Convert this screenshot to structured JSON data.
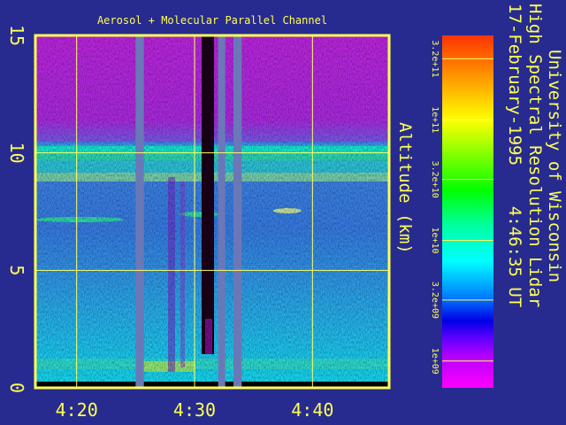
{
  "chart_data": {
    "type": "heatmap",
    "title": "Aerosol + Molecular Parallel Channel",
    "ylabel": "Altitude (km)",
    "xlabel": "",
    "ylim": [
      0,
      15
    ],
    "xlim_minutes": [
      256.5,
      286.5
    ],
    "x_ticks": [
      {
        "label": "4:20",
        "minutes": 260
      },
      {
        "label": "4:30",
        "minutes": 270
      },
      {
        "label": "4:40",
        "minutes": 280
      }
    ],
    "y_ticks": [
      {
        "label": "0",
        "value": 0
      },
      {
        "label": "5",
        "value": 5
      },
      {
        "label": "10",
        "value": 10
      },
      {
        "label": "15",
        "value": 15
      }
    ],
    "grid": true,
    "colorbar": {
      "scale": "log",
      "range": [
        600000000.0,
        500000000000.0
      ],
      "tick_labels": [
        "3.2e+11",
        "1e+11",
        "3.2e+10",
        "1e+10",
        "3.2e+09",
        "1e+09"
      ],
      "tick_values": [
        320000000000.0,
        100000000000.0,
        32000000000.0,
        10000000000.0,
        3200000000.0,
        1000000000.0
      ]
    },
    "side_text": {
      "line1": "University of Wisconsin",
      "line2": "High Spectral Resolution Lidar",
      "line3": "17-February-1995    4:46:35 UT"
    },
    "no_data_gaps_minutes": [
      [
        265.0,
        265.7
      ],
      [
        272.0,
        272.6
      ],
      [
        273.3,
        274.0
      ]
    ]
  },
  "colors": {
    "background": "#272b8f",
    "frame": "#ffff55",
    "grid": "#ffff66",
    "text": "#ffff55",
    "gap": "#6a78b8"
  }
}
